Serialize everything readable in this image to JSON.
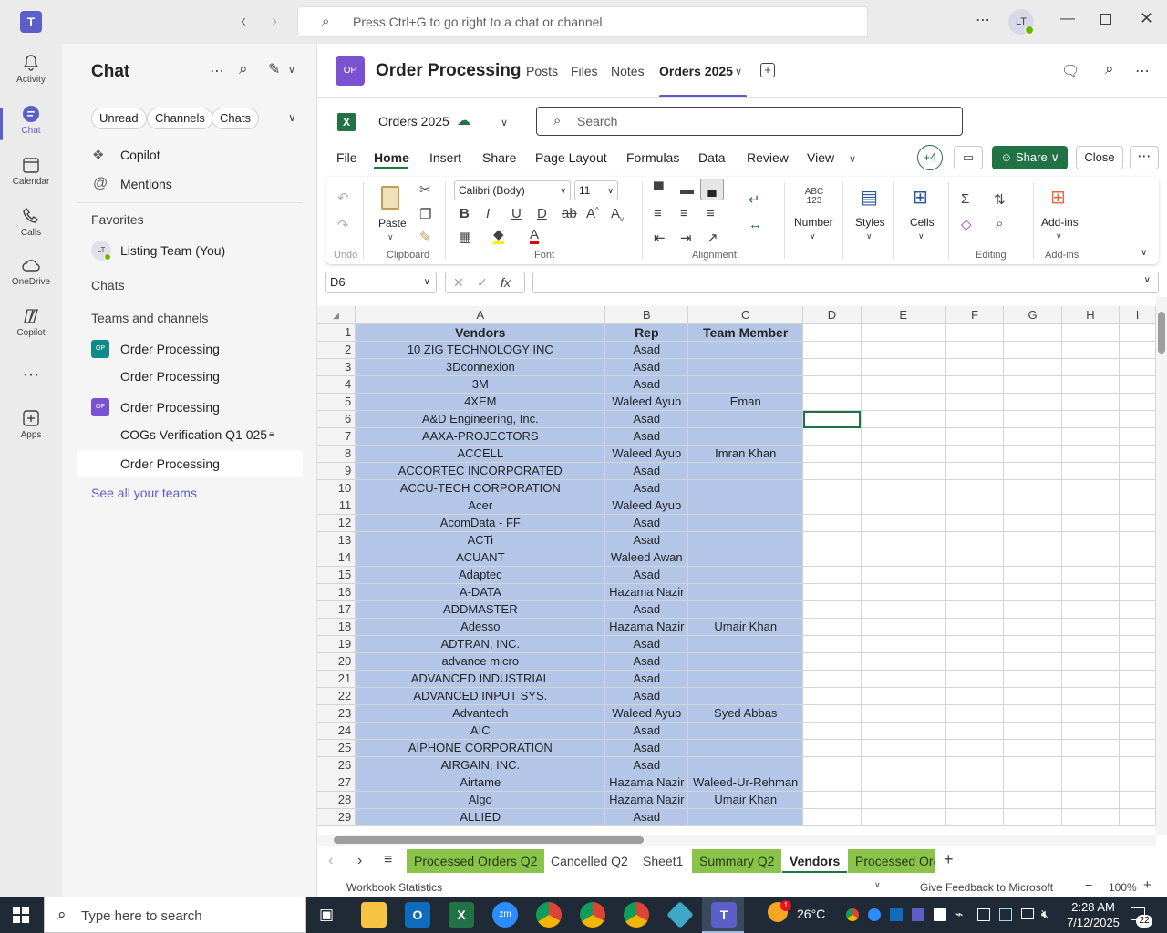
{
  "titlebar": {
    "search_placeholder": "Press Ctrl+G to go right to a chat or channel",
    "avatar": "LT"
  },
  "rail": [
    {
      "label": "Activity",
      "icon": "bell-icon"
    },
    {
      "label": "Chat",
      "icon": "chat-icon"
    },
    {
      "label": "Calendar",
      "icon": "calendar-icon"
    },
    {
      "label": "Calls",
      "icon": "phone-icon"
    },
    {
      "label": "OneDrive",
      "icon": "cloud-icon"
    },
    {
      "label": "Copilot",
      "icon": "copilot-icon"
    },
    {
      "label": "",
      "icon": "more-icon"
    },
    {
      "label": "Apps",
      "icon": "apps-icon"
    }
  ],
  "chat": {
    "title": "Chat",
    "filters": [
      "Unread",
      "Channels",
      "Chats"
    ],
    "copilot": "Copilot",
    "mentions": "Mentions",
    "favorites": "Favorites",
    "favorite_item": "Listing Team (You)",
    "favorite_avatar": "LT",
    "chats": "Chats",
    "teams_and_channels": "Teams and channels",
    "team1": "Order Processing",
    "team1_channel": "Order Processing",
    "team2": "Order Processing",
    "team2_channel1": "COGs Verification Q1 025",
    "team2_channel2": "Order Processing",
    "see_all": "See all your teams",
    "team_avatar": "OP"
  },
  "header": {
    "avatar": "OP",
    "title": "Order Processing",
    "tabs": [
      "Posts",
      "Files",
      "Notes",
      "Orders 2025"
    ]
  },
  "excel": {
    "file_name": "Orders 2025",
    "search_placeholder": "Search",
    "menu": [
      "File",
      "Home",
      "Insert",
      "Share",
      "Page Layout",
      "Formulas",
      "Data",
      "Review",
      "View"
    ],
    "plus_count": "+4",
    "share": "Share",
    "close": "Close",
    "font_name": "Calibri (Body)",
    "font_size": "11",
    "groups": {
      "undo": "Undo",
      "clipboard": "Clipboard",
      "font": "Font",
      "alignment": "Alignment",
      "editing": "Editing",
      "addins": "Add-ins"
    },
    "buttons": {
      "paste": "Paste",
      "number": "Number",
      "styles": "Styles",
      "cells": "Cells",
      "addins": "Add-ins",
      "number_icon": "ABC\n123"
    },
    "name_box": "D6",
    "columns": [
      "A",
      "B",
      "C",
      "D",
      "E",
      "F",
      "G",
      "H",
      "I"
    ],
    "header_row": [
      "Vendors",
      "Rep",
      "Team Member"
    ],
    "rows": [
      [
        "10 ZIG TECHNOLOGY INC",
        "Asad",
        ""
      ],
      [
        "3Dconnexion",
        "Asad",
        ""
      ],
      [
        "3M",
        "Asad",
        ""
      ],
      [
        "4XEM",
        "Waleed Ayub",
        "Eman"
      ],
      [
        "A&D Engineering, Inc.",
        "Asad",
        ""
      ],
      [
        "AAXA-PROJECTORS",
        "Asad",
        ""
      ],
      [
        "ACCELL",
        "Waleed Ayub",
        "Imran Khan"
      ],
      [
        "ACCORTEC INCORPORATED",
        "Asad",
        ""
      ],
      [
        "ACCU-TECH CORPORATION",
        "Asad",
        ""
      ],
      [
        "Acer",
        "Waleed Ayub",
        ""
      ],
      [
        "AcomData - FF",
        "Asad",
        ""
      ],
      [
        "ACTi",
        "Asad",
        ""
      ],
      [
        "ACUANT",
        "Waleed Awan",
        ""
      ],
      [
        "Adaptec",
        "Asad",
        ""
      ],
      [
        "A-DATA",
        "Hazama Nazir",
        ""
      ],
      [
        "ADDMASTER",
        "Asad",
        ""
      ],
      [
        "Adesso",
        "Hazama Nazir",
        "Umair Khan"
      ],
      [
        "ADTRAN, INC.",
        "Asad",
        ""
      ],
      [
        "advance micro",
        "Asad",
        ""
      ],
      [
        "ADVANCED INDUSTRIAL",
        "Asad",
        ""
      ],
      [
        "ADVANCED INPUT SYS.",
        "Asad",
        ""
      ],
      [
        "Advantech",
        "Waleed Ayub",
        "Syed Abbas"
      ],
      [
        "AIC",
        "Asad",
        ""
      ],
      [
        "AIPHONE CORPORATION",
        "Asad",
        ""
      ],
      [
        "AIRGAIN, INC.",
        "Asad",
        ""
      ],
      [
        "Airtame",
        "Hazama Nazir",
        "Waleed-Ur-Rehman"
      ],
      [
        "Algo",
        "Hazama Nazir",
        "Umair Khan"
      ],
      [
        "ALLIED",
        "Asad",
        ""
      ]
    ],
    "sheet_tabs": [
      "Processed Orders Q2",
      "Cancelled Q2",
      "Sheet1",
      "Summary Q2",
      "Vendors",
      "Processed Orc"
    ],
    "status": {
      "workbook_stats": "Workbook Statistics",
      "feedback": "Give Feedback to Microsoft",
      "zoom": "100%"
    }
  },
  "taskbar": {
    "search_placeholder": "Type here to search",
    "temperature": "26°C",
    "time": "2:28 AM",
    "date": "7/12/2025",
    "notif_count": "22",
    "weather_badge": "1"
  },
  "colors": {
    "accent": "#5b5fc7",
    "excel_green": "#217346",
    "fill_blue": "#b4c6e7",
    "tab_green": "#8bc34a",
    "team_teal": "#0f8a8a",
    "team_purple": "#7a52d1"
  }
}
